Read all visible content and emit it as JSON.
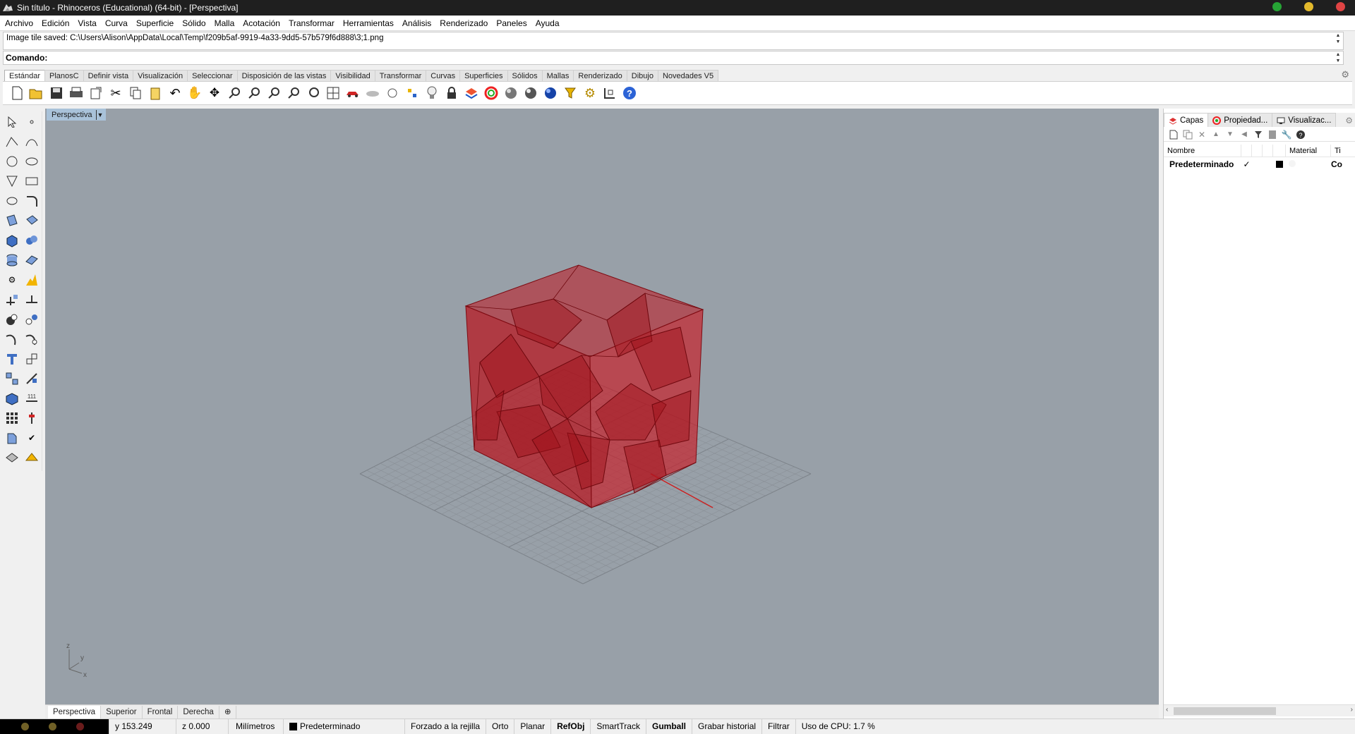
{
  "window": {
    "title": "Sin título - Rhinoceros (Educational) (64-bit) - [Perspectiva]",
    "traffic_colors": [
      "#26a435",
      "#e3b92c",
      "#e04444"
    ]
  },
  "menu": [
    "Archivo",
    "Edición",
    "Vista",
    "Curva",
    "Superficie",
    "Sólido",
    "Malla",
    "Acotación",
    "Transformar",
    "Herramientas",
    "Análisis",
    "Renderizado",
    "Paneles",
    "Ayuda"
  ],
  "command": {
    "history": "Image tile saved: C:\\Users\\Alison\\AppData\\Local\\Temp\\f209b5af-9919-4a33-9dd5-57b579f6d888\\3;1.png",
    "label": "Comando:",
    "value": ""
  },
  "toolbar_tabs": [
    "Estándar",
    "PlanosC",
    "Definir vista",
    "Visualización",
    "Seleccionar",
    "Disposición de las vistas",
    "Visibilidad",
    "Transformar",
    "Curvas",
    "Superficies",
    "Sólidos",
    "Mallas",
    "Renderizado",
    "Dibujo",
    "Novedades V5"
  ],
  "toolbar_icons": [
    "new-file-icon",
    "open-file-icon",
    "save-icon",
    "print-icon",
    "export-icon",
    "cut-icon",
    "copy-icon",
    "paste-icon",
    "undo-icon",
    "pan-hand-icon",
    "rotate-view-icon",
    "zoom-icon",
    "zoom-window-icon",
    "zoom-extents-icon",
    "zoom-selected-icon",
    "undo-view-icon",
    "viewport-layout-icon",
    "car-icon",
    "hide-icon",
    "show-icon",
    "point-edit-icon",
    "light-bulb-icon",
    "lock-icon",
    "layer-icon",
    "color-wheel-icon",
    "shaded-sphere-icon",
    "rendered-sphere-icon",
    "material-sphere-icon",
    "select-filter-icon",
    "options-gear-icon",
    "grid-snap-icon",
    "help-icon"
  ],
  "viewport": {
    "title": "Perspectiva",
    "axis_labels": {
      "z": "z",
      "y": "y",
      "x": "x"
    },
    "tabs": [
      "Perspectiva",
      "Superior",
      "Frontal",
      "Derecha"
    ],
    "add_tab_symbol": "⊕",
    "background": "#98a0a8",
    "object_color": "#c0141e"
  },
  "status": {
    "y": "y 153.249",
    "z": "z 0.000",
    "units": "Milímetros",
    "layer": "Predeterminado",
    "items": [
      {
        "label": "Forzado a la rejilla",
        "bold": false
      },
      {
        "label": "Orto",
        "bold": false
      },
      {
        "label": "Planar",
        "bold": false
      },
      {
        "label": "RefObj",
        "bold": true
      },
      {
        "label": "SmartTrack",
        "bold": false
      },
      {
        "label": "Gumball",
        "bold": true
      },
      {
        "label": "Grabar historial",
        "bold": false
      },
      {
        "label": "Filtrar",
        "bold": false
      }
    ],
    "cpu": "Uso de CPU: 1.7 %"
  },
  "panel": {
    "tabs": [
      {
        "label": "Capas",
        "icon": "layers-icon"
      },
      {
        "label": "Propiedad...",
        "icon": "properties-icon"
      },
      {
        "label": "Visualizac...",
        "icon": "display-icon"
      }
    ],
    "columns": [
      "Nombre",
      "Material",
      "Ti"
    ],
    "layers": [
      {
        "name": "Predeterminado",
        "current": "✓",
        "color": "#000000",
        "type": "Co"
      }
    ]
  }
}
